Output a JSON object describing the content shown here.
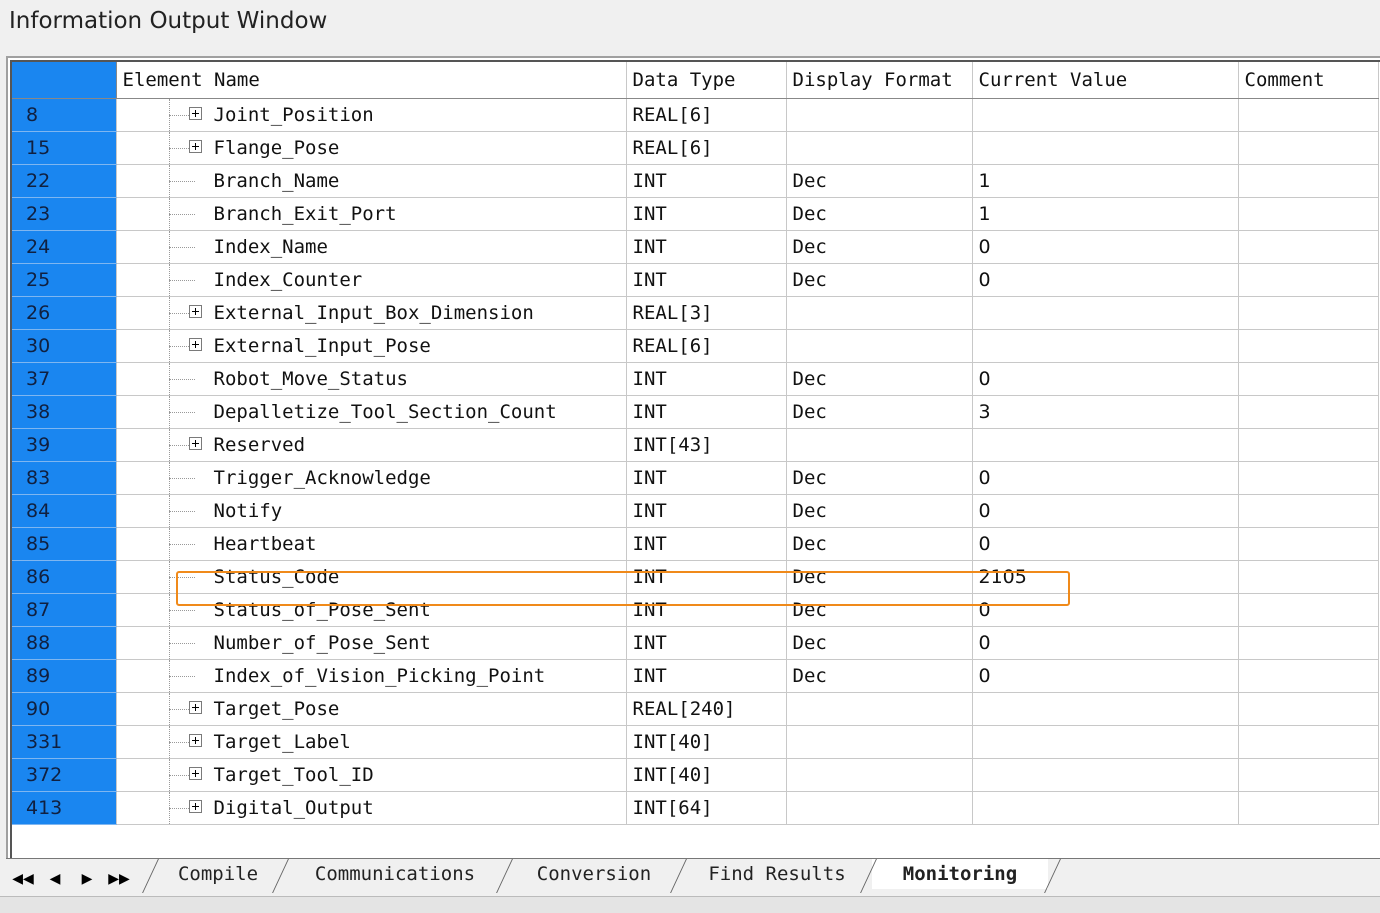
{
  "window": {
    "title": "Information Output Window"
  },
  "columns": {
    "element_name": "Element Name",
    "data_type": "Data Type",
    "display_format": "Display Format",
    "current_value": "Current Value",
    "comment": "Comment"
  },
  "rows": [
    {
      "index": "8",
      "name": "Joint_Position",
      "type": "REAL[6]",
      "format": "",
      "value": "",
      "expandable": true
    },
    {
      "index": "15",
      "name": "Flange_Pose",
      "type": "REAL[6]",
      "format": "",
      "value": "",
      "expandable": true
    },
    {
      "index": "22",
      "name": "Branch_Name",
      "type": "INT",
      "format": "Dec",
      "value": "1",
      "expandable": false
    },
    {
      "index": "23",
      "name": "Branch_Exit_Port",
      "type": "INT",
      "format": "Dec",
      "value": "1",
      "expandable": false
    },
    {
      "index": "24",
      "name": "Index_Name",
      "type": "INT",
      "format": "Dec",
      "value": "0",
      "expandable": false
    },
    {
      "index": "25",
      "name": "Index_Counter",
      "type": "INT",
      "format": "Dec",
      "value": "0",
      "expandable": false
    },
    {
      "index": "26",
      "name": "External_Input_Box_Dimension",
      "type": "REAL[3]",
      "format": "",
      "value": "",
      "expandable": true
    },
    {
      "index": "30",
      "name": "External_Input_Pose",
      "type": "REAL[6]",
      "format": "",
      "value": "",
      "expandable": true
    },
    {
      "index": "37",
      "name": "Robot_Move_Status",
      "type": "INT",
      "format": "Dec",
      "value": "0",
      "expandable": false
    },
    {
      "index": "38",
      "name": "Depalletize_Tool_Section_Count",
      "type": "INT",
      "format": "Dec",
      "value": "3",
      "expandable": false
    },
    {
      "index": "39",
      "name": "Reserved",
      "type": "INT[43]",
      "format": "",
      "value": "",
      "expandable": true
    },
    {
      "index": "83",
      "name": "Trigger_Acknowledge",
      "type": "INT",
      "format": "Dec",
      "value": "0",
      "expandable": false
    },
    {
      "index": "84",
      "name": "Notify",
      "type": "INT",
      "format": "Dec",
      "value": "0",
      "expandable": false
    },
    {
      "index": "85",
      "name": "Heartbeat",
      "type": "INT",
      "format": "Dec",
      "value": "0",
      "expandable": false
    },
    {
      "index": "86",
      "name": "Status_Code",
      "type": "INT",
      "format": "Dec",
      "value": "2105",
      "expandable": false,
      "highlighted": true
    },
    {
      "index": "87",
      "name": "Status_of_Pose_Sent",
      "type": "INT",
      "format": "Dec",
      "value": "0",
      "expandable": false
    },
    {
      "index": "88",
      "name": "Number_of_Pose_Sent",
      "type": "INT",
      "format": "Dec",
      "value": "0",
      "expandable": false
    },
    {
      "index": "89",
      "name": "Index_of_Vision_Picking_Point",
      "type": "INT",
      "format": "Dec",
      "value": "0",
      "expandable": false
    },
    {
      "index": "90",
      "name": "Target_Pose",
      "type": "REAL[240]",
      "format": "",
      "value": "",
      "expandable": true
    },
    {
      "index": "331",
      "name": "Target_Label",
      "type": "INT[40]",
      "format": "",
      "value": "",
      "expandable": true
    },
    {
      "index": "372",
      "name": "Target_Tool_ID",
      "type": "INT[40]",
      "format": "",
      "value": "",
      "expandable": true
    },
    {
      "index": "413",
      "name": "Digital_Output",
      "type": "INT[64]",
      "format": "",
      "value": "",
      "expandable": true
    }
  ],
  "tabs": [
    {
      "label": "Compile",
      "active": false
    },
    {
      "label": "Communications",
      "active": false
    },
    {
      "label": "Conversion",
      "active": false
    },
    {
      "label": "Find Results",
      "active": false
    },
    {
      "label": "Monitoring",
      "active": true
    }
  ],
  "highlight_color": "#f08a1a",
  "index_column_color": "#1a86f0"
}
